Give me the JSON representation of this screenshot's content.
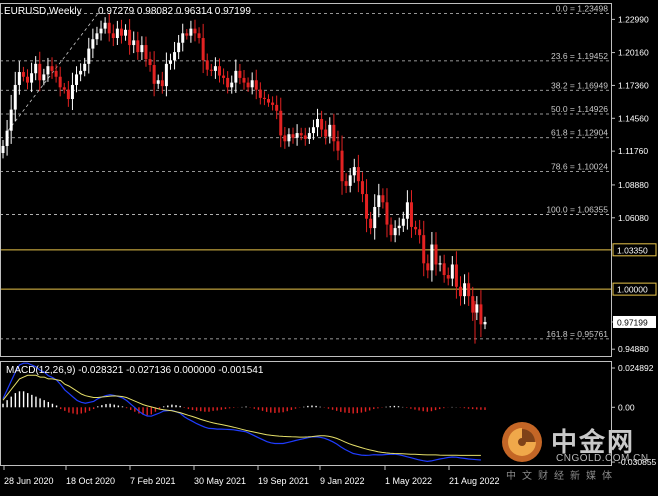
{
  "chart_data": [
    {
      "type": "candlestick",
      "title": "EURUSD,Weekly",
      "ohlc_text": "0.97279 0.98082 0.96314 0.97199",
      "x_ticks": [
        "28 Jun 2020",
        "18 Oct 2020",
        "7 Feb 2021",
        "30 May 2021",
        "19 Sep 2021",
        "9 Jan 2022",
        "1 May 2022",
        "21 Aug 2022"
      ],
      "y_ticks": [
        "1.22990",
        "1.20160",
        "1.17360",
        "1.14560",
        "1.11760",
        "1.08880",
        "1.06080",
        "1.03350",
        "1.00000",
        "0.97199",
        "0.94880"
      ],
      "ylim": [
        0.943,
        1.243
      ],
      "current_price": "0.97199",
      "levels": [
        {
          "price": 1.0335,
          "label": "1.03350",
          "color": "#e8c44a"
        },
        {
          "price": 1.0,
          "label": "1.00000",
          "color": "#e8c44a"
        }
      ],
      "fibonacci": [
        {
          "ratio": "0.0",
          "price": 1.23498,
          "label": "0.0 = 1.23498"
        },
        {
          "ratio": "23.6",
          "price": 1.19452,
          "label": "23.6 = 1.19452"
        },
        {
          "ratio": "38.2",
          "price": 1.16949,
          "label": "38.2 = 1.16949"
        },
        {
          "ratio": "50.0",
          "price": 1.14926,
          "label": "50.0 = 1.14926"
        },
        {
          "ratio": "61.8",
          "price": 1.12904,
          "label": "61.8 = 1.12904"
        },
        {
          "ratio": "78.6",
          "price": 1.10024,
          "label": "78.6 = 1.10024"
        },
        {
          "ratio": "100.0",
          "price": 1.06355,
          "label": "100.0 = 1.06355"
        },
        {
          "ratio": "161.8",
          "price": 0.95761,
          "label": "161.8 = 0.95761"
        }
      ],
      "close_series": [
        1.122,
        1.135,
        1.153,
        1.174,
        1.185,
        1.181,
        1.176,
        1.184,
        1.192,
        1.178,
        1.183,
        1.19,
        1.186,
        1.181,
        1.172,
        1.17,
        1.162,
        1.174,
        1.183,
        1.186,
        1.192,
        1.205,
        1.213,
        1.218,
        1.222,
        1.227,
        1.218,
        1.214,
        1.222,
        1.216,
        1.221,
        1.208,
        1.212,
        1.202,
        1.208,
        1.196,
        1.191,
        1.175,
        1.178,
        1.173,
        1.192,
        1.195,
        1.202,
        1.21,
        1.218,
        1.216,
        1.222,
        1.218,
        1.214,
        1.195,
        1.187,
        1.186,
        1.19,
        1.182,
        1.18,
        1.172,
        1.176,
        1.186,
        1.18,
        1.176,
        1.172,
        1.178,
        1.17,
        1.163,
        1.162,
        1.159,
        1.157,
        1.152,
        1.131,
        1.126,
        1.132,
        1.129,
        1.133,
        1.131,
        1.128,
        1.133,
        1.138,
        1.145,
        1.136,
        1.13,
        1.14,
        1.126,
        1.118,
        1.092,
        1.088,
        1.097,
        1.104,
        1.092,
        1.081,
        1.06,
        1.052,
        1.07,
        1.08,
        1.074,
        1.055,
        1.046,
        1.052,
        1.054,
        1.06,
        1.074,
        1.053,
        1.051,
        1.046,
        1.022,
        1.016,
        1.038,
        1.021,
        1.022,
        1.012,
        1.009,
        1.021,
        1.002,
        0.994,
        1.005,
        0.994,
        0.98,
        0.987,
        0.97,
        0.972
      ]
    },
    {
      "type": "histogram+line",
      "title": "MACD(12,26,9) -0.028321 -0.027136 0.000000 -0.001541",
      "y_ticks": [
        "0.024892",
        "0.00",
        "-0.030855"
      ],
      "ylim": [
        -0.0325,
        0.0255
      ],
      "histogram": [
        0.002,
        0.004,
        0.006,
        0.008,
        0.009,
        0.009,
        0.008,
        0.007,
        0.006,
        0.005,
        0.004,
        0.003,
        0.002,
        0.001,
        -0.001,
        -0.002,
        -0.003,
        -0.0035,
        -0.004,
        -0.0035,
        -0.003,
        -0.002,
        -0.001,
        0.0005,
        0.0012,
        0.0018,
        0.002,
        0.0015,
        0.001,
        0.0005,
        -0.0005,
        -0.0015,
        -0.0025,
        -0.0035,
        -0.0042,
        -0.0045,
        -0.004,
        -0.0025,
        -0.001,
        0.0005,
        0.001,
        0.0015,
        0.0012,
        0.0008,
        -0.0003,
        -0.001,
        -0.0015,
        -0.002,
        -0.0022,
        -0.0025,
        -0.0025,
        -0.002,
        -0.0018,
        -0.0014,
        -0.001,
        -0.0006,
        -0.0003,
        -0.0001,
        0.0002,
        0.0004,
        -0.0002,
        -0.0008,
        -0.0014,
        -0.002,
        -0.0026,
        -0.003,
        -0.0032,
        -0.003,
        -0.0028,
        -0.0022,
        -0.0015,
        -0.0008,
        -0.0002,
        0.0003,
        0.0008,
        0.001,
        0.0008,
        0.0003,
        -0.0002,
        -0.0008,
        -0.0014,
        -0.002,
        -0.0026,
        -0.003,
        -0.0032,
        -0.0035,
        -0.0033,
        -0.003,
        -0.0025,
        -0.0018,
        -0.001,
        -0.0006,
        -0.0002,
        0.0003,
        0.0006,
        0.0008,
        0.0006,
        0.0002,
        -0.0003,
        -0.0008,
        -0.0013,
        -0.0018,
        -0.0022,
        -0.0025,
        -0.0022,
        -0.0016,
        -0.001,
        -0.0005,
        -0.0001,
        0.0002,
        0.0001,
        -0.0002,
        -0.0005,
        -0.0008,
        -0.001,
        -0.0012,
        -0.0014,
        -0.0015
      ],
      "signal": [
        0.004,
        0.007,
        0.01,
        0.013,
        0.016,
        0.017,
        0.018,
        0.018,
        0.018,
        0.017,
        0.017,
        0.016,
        0.016,
        0.0155,
        0.015,
        0.013,
        0.012,
        0.0105,
        0.009,
        0.0075,
        0.0065,
        0.006,
        0.0055,
        0.0055,
        0.0058,
        0.006,
        0.0063,
        0.0064,
        0.0063,
        0.006,
        0.0055,
        0.0045,
        0.0035,
        0.0025,
        0.0015,
        0.0008,
        0.0002,
        -0.0004,
        -0.001,
        -0.0014,
        -0.0017,
        -0.002,
        -0.0025,
        -0.003,
        -0.0038,
        -0.0045,
        -0.0052,
        -0.006,
        -0.0068,
        -0.0075,
        -0.0082,
        -0.0088,
        -0.0093,
        -0.0097,
        -0.0102,
        -0.0107,
        -0.0112,
        -0.0118,
        -0.0124,
        -0.013,
        -0.0135,
        -0.014,
        -0.0145,
        -0.015,
        -0.0155,
        -0.0158,
        -0.016,
        -0.0162,
        -0.0164,
        -0.0165,
        -0.0166,
        -0.0167,
        -0.0168,
        -0.0168,
        -0.0167,
        -0.0165,
        -0.0162,
        -0.016,
        -0.016,
        -0.0163,
        -0.0168,
        -0.0175,
        -0.0185,
        -0.0195,
        -0.0205,
        -0.0213,
        -0.022,
        -0.0227,
        -0.0234,
        -0.024,
        -0.0245,
        -0.025,
        -0.0254,
        -0.0257,
        -0.0259,
        -0.026,
        -0.0261,
        -0.0262,
        -0.0263,
        -0.0264,
        -0.0265,
        -0.0266,
        -0.0267,
        -0.0268,
        -0.0268,
        -0.0268,
        -0.0269,
        -0.027,
        -0.027,
        -0.027,
        -0.027,
        -0.0271,
        -0.0271,
        -0.0271,
        -0.0271,
        -0.0271,
        -0.0271
      ]
    }
  ],
  "watermark": {
    "brand_cn": "中金网",
    "brand_en": "CNGOLD.COM.CN",
    "slogan_cn": "中文财经新媒体"
  },
  "colors": {
    "background": "#000000",
    "bull": "#ffffff",
    "bear": "#e32222",
    "fib": "#c8c8c8",
    "level": "#e8c44a",
    "macd_hist_pos": "#ffffff",
    "macd_hist_neg": "#e32222",
    "macd_main": "#1f3cff",
    "macd_signal": "#e6e06a",
    "frame": "#bfbfbf"
  }
}
